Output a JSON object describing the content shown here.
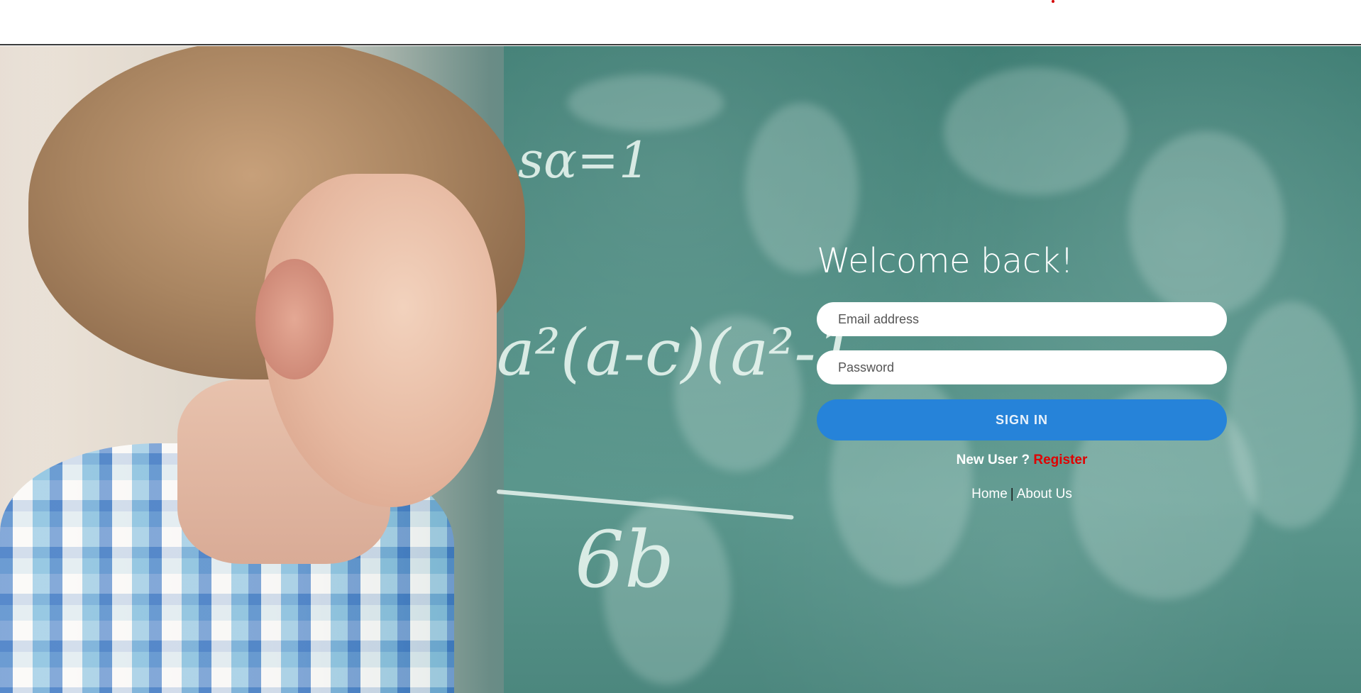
{
  "header": {
    "accent_color": "#d40000"
  },
  "hero": {
    "image": "boy-leaning-on-chalkboard"
  },
  "login": {
    "title": "Welcome back!",
    "email_placeholder": "Email address",
    "password_placeholder": "Password",
    "signin_label": "SIGN IN",
    "new_user_text": "New User ?",
    "register_label": "Register",
    "nav": {
      "home_label": "Home",
      "separator": "|",
      "about_label": "About Us"
    }
  },
  "colors": {
    "button": "#2683d9",
    "register_link": "#e00000",
    "title_text": "#ffffff"
  }
}
